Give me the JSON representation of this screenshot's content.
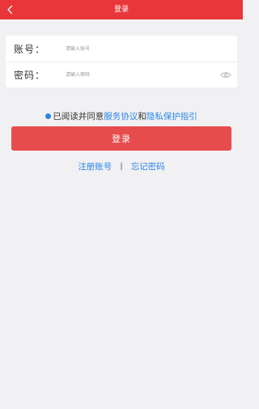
{
  "navbar": {
    "title": "登录",
    "back_icon": "chevron-left-icon",
    "bg_color": "#e9363b"
  },
  "form": {
    "account": {
      "label": "账号：",
      "placeholder": "请输入账号",
      "value": ""
    },
    "password": {
      "label": "密码：",
      "placeholder": "请输入密码",
      "value": "",
      "toggle_icon": "eye-icon"
    }
  },
  "agreement": {
    "prefix": "已阅读并同意",
    "service_link": "服务协议",
    "conjunction": "和",
    "privacy_link": "隐私保护指引",
    "checked": true,
    "link_color": "#2a84e6"
  },
  "login_button": {
    "label": "登录",
    "bg_color": "#e74c4d"
  },
  "links": {
    "register": "注册账号",
    "separator": "|",
    "forgot": "忘记密码"
  }
}
